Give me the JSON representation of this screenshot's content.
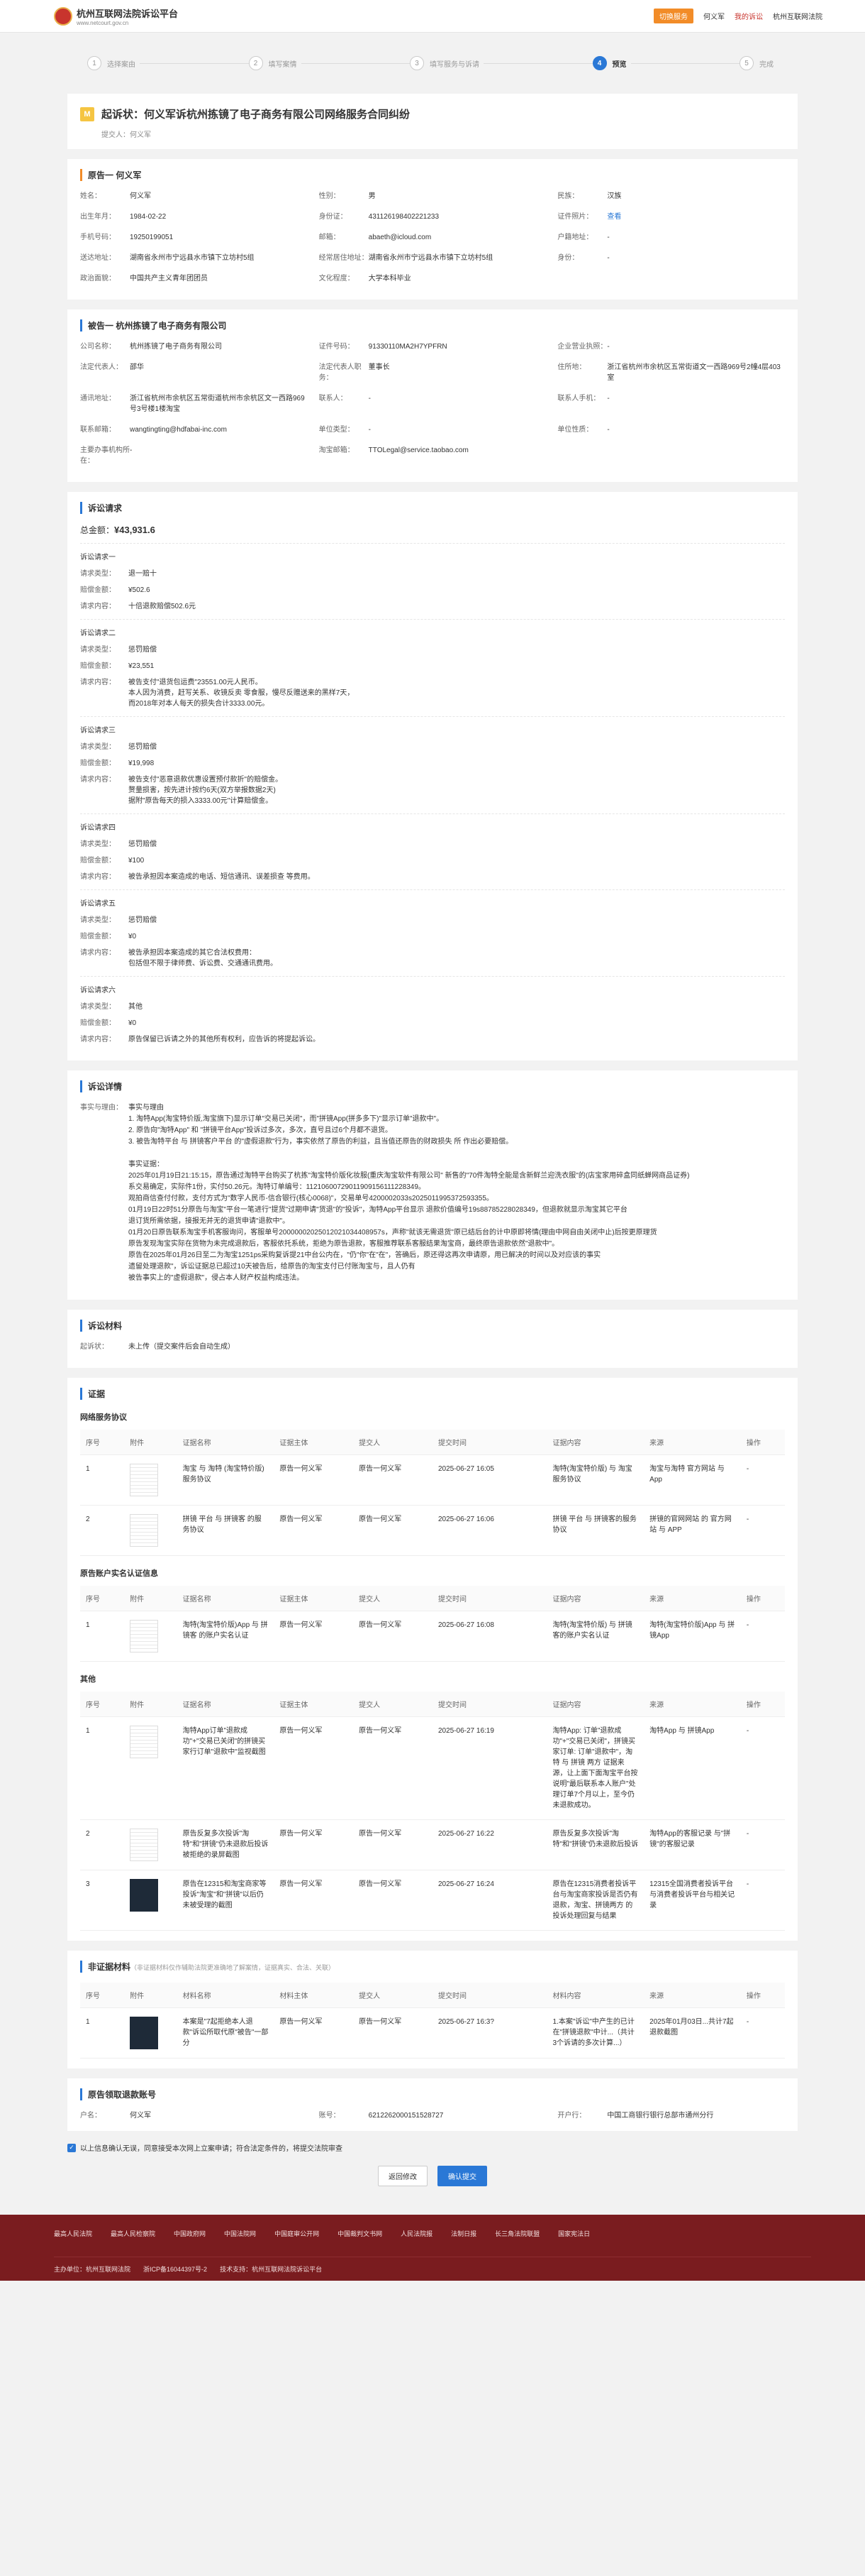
{
  "header": {
    "title": "杭州互联网法院诉讼平台",
    "subtitle": "www.netcourt.gov.cn",
    "switch_label": "切换服务",
    "user": "何义军",
    "my_case": "我的诉讼",
    "court": "杭州互联网法院"
  },
  "steps": [
    {
      "num": "1",
      "label": "选择案由"
    },
    {
      "num": "2",
      "label": "填写案情"
    },
    {
      "num": "3",
      "label": "填写服务与诉请"
    },
    {
      "num": "4",
      "label": "预览"
    },
    {
      "num": "5",
      "label": "完成"
    }
  ],
  "case": {
    "badge": "M",
    "title": "起诉状：何义军诉杭州拣镜了电子商务有限公司网络服务合同纠纷",
    "submitter_label": "提交人：",
    "submitter": "何义军"
  },
  "plaintiff": {
    "section": "原告一 何义军",
    "rows": [
      {
        "k": "姓名：",
        "v": "何义军"
      },
      {
        "k": "性别：",
        "v": "男"
      },
      {
        "k": "民族：",
        "v": "汉族"
      },
      {
        "k": "出生年月：",
        "v": "1984-02-22"
      },
      {
        "k": "身份证：",
        "v": "431126198402221233"
      },
      {
        "k": "证件照片：",
        "v": "查看"
      },
      {
        "k": "手机号码：",
        "v": "19250199051"
      },
      {
        "k": "邮箱：",
        "v": "abaeth@icloud.com"
      },
      {
        "k": "户籍地址：",
        "v": "-"
      },
      {
        "k": "送达地址：",
        "v": "湖南省永州市宁远县水市镇下立坊村5组"
      },
      {
        "k": "经常居住地址：",
        "v": "湖南省永州市宁远县水市镇下立坊村5组"
      },
      {
        "k": "身份：",
        "v": "-"
      },
      {
        "k": "政治面貌：",
        "v": "中国共产主义青年团团员"
      },
      {
        "k": "文化程度：",
        "v": "大学本科毕业"
      },
      {
        "k": "",
        "v": ""
      }
    ]
  },
  "defendant": {
    "section": "被告一 杭州拣镜了电子商务有限公司",
    "rows": [
      {
        "k": "公司名称：",
        "v": "杭州拣镜了电子商务有限公司"
      },
      {
        "k": "证件号码：",
        "v": "91330110MA2H7YPFRN"
      },
      {
        "k": "企业营业执照：",
        "v": "-"
      },
      {
        "k": "法定代表人：",
        "v": "邵华"
      },
      {
        "k": "法定代表人职务：",
        "v": "董事长"
      },
      {
        "k": "住所地：",
        "v": "浙江省杭州市余杭区五常街道文一西路969号2幢4层403室"
      },
      {
        "k": "通讯地址：",
        "v": "浙江省杭州市余杭区五常街道杭州市余杭区文一西路969号3号楼1楼淘宝"
      },
      {
        "k": "联系人：",
        "v": "-"
      },
      {
        "k": "联系人手机：",
        "v": "-"
      },
      {
        "k": "联系邮箱：",
        "v": "wangtingting@hdfabai-inc.com"
      },
      {
        "k": "单位类型：",
        "v": "-"
      },
      {
        "k": "单位性质：",
        "v": "-"
      },
      {
        "k": "主要办事机构所在：",
        "v": "-"
      },
      {
        "k": "淘宝邮箱：",
        "v": "TTOLegal@service.taobao.com"
      },
      {
        "k": "",
        "v": ""
      }
    ]
  },
  "claims": {
    "section": "诉讼请求",
    "total_label": "总金额：",
    "total": "¥43,931.6",
    "groups": [
      {
        "name": "诉讼请求一",
        "rows": [
          {
            "k": "请求类型：",
            "v": "退一赔十"
          },
          {
            "k": "赔偿金额：",
            "v": "¥502.6"
          },
          {
            "k": "请求内容：",
            "v": "十倍退款赔偿502.6元"
          }
        ]
      },
      {
        "name": "诉讼请求二",
        "rows": [
          {
            "k": "请求类型：",
            "v": "惩罚赔偿"
          },
          {
            "k": "赔偿金额：",
            "v": "¥23,551"
          },
          {
            "k": "请求内容：",
            "v": "被告支付\"退货包运费\"23551.00元人民币。\n本人因为消费，赶写关系、收镜反卖 零食服，慢尽反赠送来的黑样7天，\n而2018年对本人每天的损失合计3333.00元。"
          }
        ]
      },
      {
        "name": "诉讼请求三",
        "rows": [
          {
            "k": "请求类型：",
            "v": "惩罚赔偿"
          },
          {
            "k": "赔偿金额：",
            "v": "¥19,998"
          },
          {
            "k": "请求内容：",
            "v": "被告支付\"恶意退款优惠设置预付款折\"的赔偿金。\n赘量损害，按先进计按约6天(双方举报数据2天)\n据附\"原告每天的损入3333.00元\"计算赔偿金。"
          }
        ]
      },
      {
        "name": "诉讼请求四",
        "rows": [
          {
            "k": "请求类型：",
            "v": "惩罚赔偿"
          },
          {
            "k": "赔偿金额：",
            "v": "¥100"
          },
          {
            "k": "请求内容：",
            "v": "被告承担因本案造成的电话、短信通讯、误差损查 等费用。"
          }
        ]
      },
      {
        "name": "诉讼请求五",
        "rows": [
          {
            "k": "请求类型：",
            "v": "惩罚赔偿"
          },
          {
            "k": "赔偿金额：",
            "v": "¥0"
          },
          {
            "k": "请求内容：",
            "v": "被告承担因本案造成的其它合法权费用：\n包括但不限于律师费、诉讼费、交通通讯费用。"
          }
        ]
      },
      {
        "name": "诉讼请求六",
        "rows": [
          {
            "k": "请求类型：",
            "v": "其他"
          },
          {
            "k": "赔偿金额：",
            "v": "¥0"
          },
          {
            "k": "请求内容：",
            "v": "原告保留已诉请之外的其他所有权利，应告诉的将提起诉讼。"
          }
        ]
      }
    ]
  },
  "facts": {
    "section": "诉讼详情",
    "label": "事实与理由：",
    "text": "事实与理由\n1. 淘特App(淘宝特价版,淘宝旗下)显示订单\"交易已关闭\"，而\"拼镜App(拼多多下)\"显示订单\"退款中\"。\n2. 原告向\"淘特App\" 和 \"拼镜平台App\"投诉过多次，多次，直号且过6个月都不退货。\n3. 被告淘特平台 与 拼镜客户平台 的\"虚假退款\"行为，事实依然了原告的利益，且当值还原告的财政损失 所 作出必要赔偿。\n\n事实证据：\n2025年01月19日21:15:15，原告通过淘特平台购买了杭拣\"淘宝特价版化妆服(重庆淘宝软件有限公司\" 新售的\"70件淘特全能是含新鲜兰迎洗衣服\"的(店宝家用碎盒同纸蝉网商品证券)\n系交易确定，实际件1份，实付50.26元。淘特订单编号：11210600729011909156111228349。\n观拍商信查付付款，支付方式为\"数字人民币-信合银行(核心0068)\"，交易单号4200002033s2025011995372593355。\n01月19日22时51分原告与淘宝\"平台一笔进行\"提货\"过期申请\"货退\"的\"投诉\"，淘特App平台显示 退款价值编号19s88785228028349，但退款就显示淘宝其它平台\n退订货所需依据，接报无并无的退货申请\"退款中\"。\n01月20日原告联系淘宝手机客服询问，客服单号20000002025012021034408957s，声称\"就该无需退货\"原已结后台的计中原即将情(理由中网自由关闭中止)后按更原理货\n原告发现淘宝实际在货物为未完成退款后，客服依托系统，拒绝为原告退款，客服推荐联系客服结果淘宝商，最终原告退款依然\"退款中\"。\n原告在2025年01月26日至二为淘宝1251ps采购复诉提21中台公内在，\"仍\"你\"在\"在\"，答确后，原还得这再次申请原，用已解决的时间以及对应该的事实\n遗留处理退款\"，诉讼证据总已超过10天被告后，给原告的淘宝支付已付账淘宝与，且人仍有\n被告事实上的\"虚假退款\"，侵占本人财产权益构成违法。"
  },
  "materials": {
    "section": "诉讼材料",
    "label": "起诉状：",
    "value": "未上传（提交案件后会自动生成）"
  },
  "evidence": {
    "section": "证据",
    "headers": [
      "序号",
      "附件",
      "证据名称",
      "证据主体",
      "提交人",
      "提交时间",
      "证据内容",
      "来源",
      "操作"
    ],
    "groups": [
      {
        "title": "网络服务协议",
        "rows": [
          {
            "no": "1",
            "name": "淘宝 与 淘特 (淘宝特价版) 服务协议",
            "subject": "原告一何义军",
            "submitter": "原告一何义军",
            "time": "2025-06-27 16:05",
            "content": "淘特(淘宝特价版) 与 淘宝 服务协议",
            "source": "淘宝与淘特 官方网站 与 App",
            "op": "-",
            "dark": false
          },
          {
            "no": "2",
            "name": "拼镜 平台 与 拼镜客 的服务协议",
            "subject": "原告一何义军",
            "submitter": "原告一何义军",
            "time": "2025-06-27 16:06",
            "content": "拼镜 平台 与 拼镜客的服务协议",
            "source": "拼镜的官网网站 的 官方网站 与 APP",
            "op": "-",
            "dark": false
          }
        ]
      },
      {
        "title": "原告账户实名认证信息",
        "rows": [
          {
            "no": "1",
            "name": "淘特(淘宝特价版)App 与 拼镜客 的账户实名认证",
            "subject": "原告一何义军",
            "submitter": "原告一何义军",
            "time": "2025-06-27 16:08",
            "content": "淘特(淘宝特价版) 与 拼镜客的账户实名认证",
            "source": "淘特(淘宝特价版)App 与 拼镜App",
            "op": "-",
            "dark": false
          }
        ]
      },
      {
        "title": "其他",
        "rows": [
          {
            "no": "1",
            "name": "淘特App订单\"退款成功\"+\"交易已关闭\"的拼镜买家行订单\"退款中\"监视截图",
            "subject": "原告一何义军",
            "submitter": "原告一何义军",
            "time": "2025-06-27 16:19",
            "content": "淘特App: 订单\"退款成功\"+\"交易已关闭\"，拼镜买家订单: 订单\"退款中\"，淘特 与 拼镜 两方 证据来源，让上面下面淘宝平台按说明\"最后联系本人账户\"处理订单7个月以上，至今仍未退款成功。",
            "source": "淘特App 与 拼镜App",
            "op": "-",
            "dark": false
          },
          {
            "no": "2",
            "name": "原告反复多次投诉\"淘特\"和\"拼镜\"仍未退款后投诉被拒绝的录屏截图",
            "subject": "原告一何义军",
            "submitter": "原告一何义军",
            "time": "2025-06-27 16:22",
            "content": "原告反复多次投诉\"淘特\"和\"拼镜\"仍未退款后投诉",
            "source": "淘特App的客服记录 与\"拼镜\"的客服记录",
            "op": "-",
            "dark": false
          },
          {
            "no": "3",
            "name": "原告在12315和淘宝商家等 投诉\"淘宝\"和\"拼镜\"以后仍未被受理的截图",
            "subject": "原告一何义军",
            "submitter": "原告一何义军",
            "time": "2025-06-27 16:24",
            "content": "原告在12315消费者投诉平台与淘宝商家投诉是否仍有退款，淘宝、拼镜两方 的投诉处理回复与结果",
            "source": "12315全国消费者投诉平台与消费者投诉平台与相关记录",
            "op": "-",
            "dark": true
          }
        ]
      }
    ]
  },
  "non_evidence": {
    "section": "非证据材料",
    "note": "（非证据材料仅作辅助法院更准确地了解案情，证据真实、合法、关联）",
    "headers": [
      "序号",
      "附件",
      "材料名称",
      "材料主体",
      "提交人",
      "提交时间",
      "材料内容",
      "来源",
      "操作"
    ],
    "rows": [
      {
        "no": "1",
        "name": "本案是\"7起拒绝本人退款\"诉讼所取代原\"被告\"一部分",
        "subject": "原告一何义军",
        "submitter": "原告一何义军",
        "time": "2025-06-27 16:3?",
        "content": "1.本案\"诉讼\"中产生的已计在\"拼镜退款\"中计...（共计3个诉请的多次计算...）",
        "source": "2025年01月03日...共计7起退款截图",
        "op": "-",
        "dark": true
      }
    ]
  },
  "bank": {
    "section": "原告领取退款账号",
    "name_label": "户名：",
    "name": "何义军",
    "account_label": "账号：",
    "account": "6212262000151528727",
    "bank_label": "开户行：",
    "bank": "中国工商银行银行总部市通州分行"
  },
  "agree_text": "以上信息确认无误，同意接受本次网上立案申请；符合法定条件的，将提交法院审查",
  "buttons": {
    "back": "返回修改",
    "submit": "确认提交"
  },
  "footer": {
    "links": [
      "最高人民法院",
      "最高人民检察院",
      "中国政府网",
      "中国法院网",
      "中国庭审公开网",
      "中国裁判文书网",
      "人民法院报",
      "法制日报",
      "长三角法院联盟",
      "国家宪法日"
    ],
    "owner": "主办单位：杭州互联网法院",
    "icp": "浙ICP备16044397号-2",
    "support": "技术支持：杭州互联网法院诉讼平台"
  }
}
